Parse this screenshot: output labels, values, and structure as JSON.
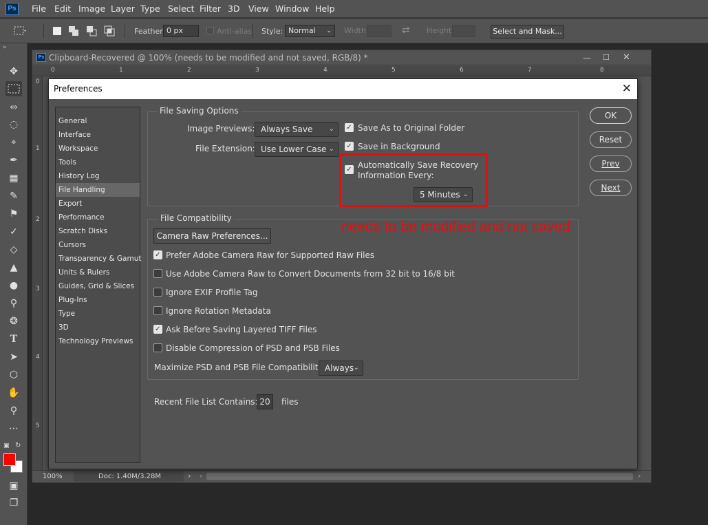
{
  "menu": {
    "logo": "Ps",
    "items": [
      "File",
      "Edit",
      "Image",
      "Layer",
      "Type",
      "Select",
      "Filter",
      "3D",
      "View",
      "Window",
      "Help"
    ]
  },
  "options": {
    "feather_label": "Feather:",
    "feather_value": "0 px",
    "antialias_label": "Anti-alias",
    "style_label": "Style:",
    "style_value": "Normal",
    "width_label": "Width:",
    "height_label": "Height:",
    "select_mask_label": "Select and Mask..."
  },
  "document": {
    "title": "Clipboard-Recovered @ 100% (needs to be modified and not saved, RGB/8) *",
    "ruler_h": [
      "0",
      "1",
      "2",
      "3",
      "4",
      "5",
      "6",
      "7",
      "8"
    ],
    "ruler_v": [
      "0",
      "1",
      "2",
      "3",
      "4",
      "5"
    ],
    "zoom": "100%",
    "doc_info": "Doc: 1.40M/3.28M"
  },
  "dialog": {
    "title": "Preferences",
    "categories": [
      "General",
      "Interface",
      "Workspace",
      "Tools",
      "History Log",
      "File Handling",
      "Export",
      "Performance",
      "Scratch Disks",
      "Cursors",
      "Transparency & Gamut",
      "Units & Rulers",
      "Guides, Grid & Slices",
      "Plug-Ins",
      "Type",
      "3D",
      "Technology Previews"
    ],
    "selected_category": "File Handling",
    "file_saving": {
      "title": "File Saving Options",
      "image_previews_label": "Image Previews:",
      "image_previews_value": "Always Save",
      "file_extension_label": "File Extension:",
      "file_extension_value": "Use Lower Case",
      "save_as_original_label": "Save As to Original Folder",
      "save_background_label": "Save in Background",
      "auto_save_label_1": "Automatically Save Recovery",
      "auto_save_label_2": "Information Every:",
      "auto_save_interval": "5 Minutes"
    },
    "compat": {
      "title": "File Compatibility",
      "camera_raw_button": "Camera Raw Preferences...",
      "options": [
        {
          "label": "Prefer Adobe Camera Raw for Supported Raw Files",
          "checked": true
        },
        {
          "label": "Use Adobe Camera Raw to Convert Documents from 32 bit to 16/8 bit",
          "checked": false
        },
        {
          "label": "Ignore EXIF Profile Tag",
          "checked": false
        },
        {
          "label": "Ignore Rotation Metadata",
          "checked": false
        },
        {
          "label": "Ask Before Saving Layered TIFF Files",
          "checked": true
        },
        {
          "label": "Disable Compression of PSD and PSB Files",
          "checked": false
        }
      ],
      "maximize_label": "Maximize PSD and PSB File Compatibility:",
      "maximize_value": "Always"
    },
    "recent": {
      "label": "Recent File List Contains:",
      "value": "20",
      "suffix": "files"
    },
    "buttons": {
      "ok": "OK",
      "reset": "Reset",
      "prev": "Prev",
      "next": "Next"
    },
    "annotation": "needs to be modified and not saved"
  },
  "colors": {
    "foreground": "#ff0000",
    "background": "#ffffff",
    "highlight": "#e01010"
  }
}
